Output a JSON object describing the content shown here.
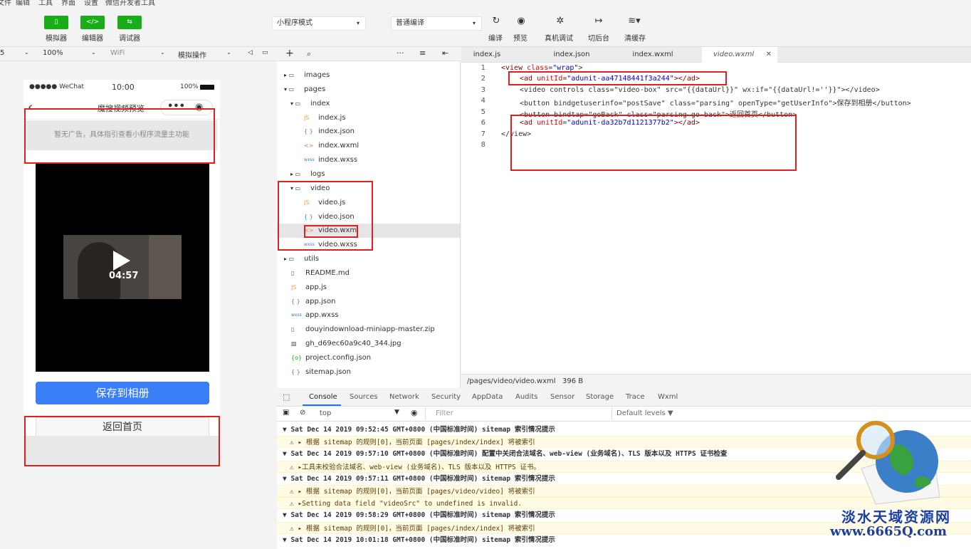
{
  "menubar": {
    "items": [
      "文件",
      "编辑",
      "工具",
      "界面",
      "设置",
      "微信开发者工具"
    ]
  },
  "toolbar": {
    "simulator_label": "模拟器",
    "editor_label": "编辑器",
    "debugger_label": "调试器",
    "mode_select": "小程序模式",
    "compile_select": "普通编译",
    "compile_label": "编译",
    "preview_label": "预览",
    "remote_debug_label": "真机调试",
    "background_label": "切后台",
    "clear_cache_label": "清缓存"
  },
  "simbar": {
    "device": "5",
    "zoom": "100%",
    "network": "WiFi",
    "ops": "模拟操作"
  },
  "phone": {
    "carrier": "●●●●● WeChat",
    "time": "10:00",
    "battery": "100%",
    "title": "魔搜视频预览",
    "ad_placeholder": "暂无广告，具体指引查看小程序流量主功能",
    "duration": "04:57",
    "save_button": "保存到相册",
    "back_button": "返回首页"
  },
  "filetree": {
    "items": [
      {
        "name": "images",
        "type": "folder",
        "depth": 0,
        "open": false
      },
      {
        "name": "pages",
        "type": "folder",
        "depth": 0,
        "open": true
      },
      {
        "name": "index",
        "type": "folder",
        "depth": 1,
        "open": true
      },
      {
        "name": "index.js",
        "type": "js",
        "depth": 2
      },
      {
        "name": "index.json",
        "type": "json",
        "depth": 2
      },
      {
        "name": "index.wxml",
        "type": "wxml",
        "depth": 2
      },
      {
        "name": "index.wxss",
        "type": "wxss",
        "depth": 2
      },
      {
        "name": "logs",
        "type": "folder",
        "depth": 1,
        "open": false
      },
      {
        "name": "video",
        "type": "folder",
        "depth": 1,
        "open": true
      },
      {
        "name": "video.js",
        "type": "js",
        "depth": 2
      },
      {
        "name": "video.json",
        "type": "json",
        "depth": 2
      },
      {
        "name": "video.wxml",
        "type": "wxml",
        "depth": 2,
        "selected": true
      },
      {
        "name": "video.wxss",
        "type": "wxss",
        "depth": 2
      },
      {
        "name": "utils",
        "type": "folder",
        "depth": 0,
        "open": false
      },
      {
        "name": "README.md",
        "type": "file",
        "depth": 0
      },
      {
        "name": "app.js",
        "type": "js",
        "depth": 0
      },
      {
        "name": "app.json",
        "type": "json",
        "depth": 0
      },
      {
        "name": "app.wxss",
        "type": "wxss",
        "depth": 0
      },
      {
        "name": "douyindownload-miniapp-master.zip",
        "type": "file",
        "depth": 0
      },
      {
        "name": "gh_d69ec60a9c40_344.jpg",
        "type": "image",
        "depth": 0
      },
      {
        "name": "project.config.json",
        "type": "config",
        "depth": 0
      },
      {
        "name": "sitemap.json",
        "type": "json",
        "depth": 0
      }
    ]
  },
  "editor": {
    "tabs": [
      "index.js",
      "index.json",
      "index.wxml",
      "video.wxml"
    ],
    "active_tab": "video.wxml",
    "line_numbers": [
      "1",
      "2",
      "3",
      "4",
      "5",
      "6",
      "7",
      "8"
    ],
    "file_path": "/pages/video/video.wxml",
    "file_size": "396 B",
    "code": {
      "l1_open": "<view ",
      "l1_attr": "class",
      "l1_eq": "=",
      "l1_val": "\"wrap\"",
      "l1_close": ">",
      "l2_open": "<ad ",
      "l2_attr": "unitId",
      "l2_val": "\"adunit-aa47148441f3a244\"",
      "l2_close": "></ad>",
      "l3": "<video controls class=\"video-box\" src=\"{{dataUrl}}\" wx:if=\"{{dataUrl!=''}}\"></video>",
      "l4": "<button bindgetuserinfo=\"postSave\" class=\"parsing\" openType=\"getUserInfo\">保存到相册</button>",
      "l5": "<button bindtap=\"goBack\" class=\"parsing go-back\">返回首页</button>",
      "l6_open": "<ad ",
      "l6_attr": "unitId",
      "l6_val": "\"adunit-da32b7d1121377b2\"",
      "l6_close": "></ad>",
      "l7": "</view>"
    }
  },
  "devtools": {
    "tabs": [
      "Console",
      "Sources",
      "Network",
      "Security",
      "AppData",
      "Audits",
      "Sensor",
      "Storage",
      "Trace",
      "Wxml"
    ],
    "active_tab": "Console",
    "context": "top",
    "filter_placeholder": "Filter",
    "levels": "Default levels ▼",
    "logs": [
      {
        "kind": "group",
        "text": "▼ Sat Dec 14 2019 09:52:45 GMT+0800 (中国标准时间) sitemap 索引情况提示"
      },
      {
        "kind": "warn",
        "text": "⚠ ▸ 根据 sitemap 的规则[0]，当前页面 [pages/index/index] 将被索引"
      },
      {
        "kind": "group",
        "text": "▼ Sat Dec 14 2019 09:57:10 GMT+0800 (中国标准时间) 配置中关闭合法域名、web-view (业务域名)、TLS 版本以及 HTTPS 证书检查"
      },
      {
        "kind": "warn",
        "text": "⚠ ▸工具未校验合法域名、web-view (业务域名)、TLS 版本以及 HTTPS 证书。"
      },
      {
        "kind": "group",
        "text": "▼ Sat Dec 14 2019 09:57:11 GMT+0800 (中国标准时间) sitemap 索引情况提示"
      },
      {
        "kind": "warn",
        "text": "⚠ ▸ 根据 sitemap 的规则[0]，当前页面 [pages/video/video] 将被索引"
      },
      {
        "kind": "warn",
        "text": "⚠ ▸Setting data field \"videoSrc\" to undefined is invalid."
      },
      {
        "kind": "group",
        "text": "▼ Sat Dec 14 2019 09:58:29 GMT+0800 (中国标准时间) sitemap 索引情况提示"
      },
      {
        "kind": "warn",
        "text": "⚠ ▸ 根据 sitemap 的规则[0]，当前页面 [pages/index/index] 将被索引"
      },
      {
        "kind": "group",
        "text": "▼ Sat Dec 14 2019 10:01:18 GMT+0800 (中国标准时间) sitemap 索引情况提示"
      }
    ]
  },
  "watermark": {
    "line1": "淡水天域资源网",
    "line2": "www.6665Q.com"
  },
  "colors": {
    "accent_green": "#1aad19",
    "save_blue": "#3a7ff6",
    "highlight_red": "#e02020"
  }
}
